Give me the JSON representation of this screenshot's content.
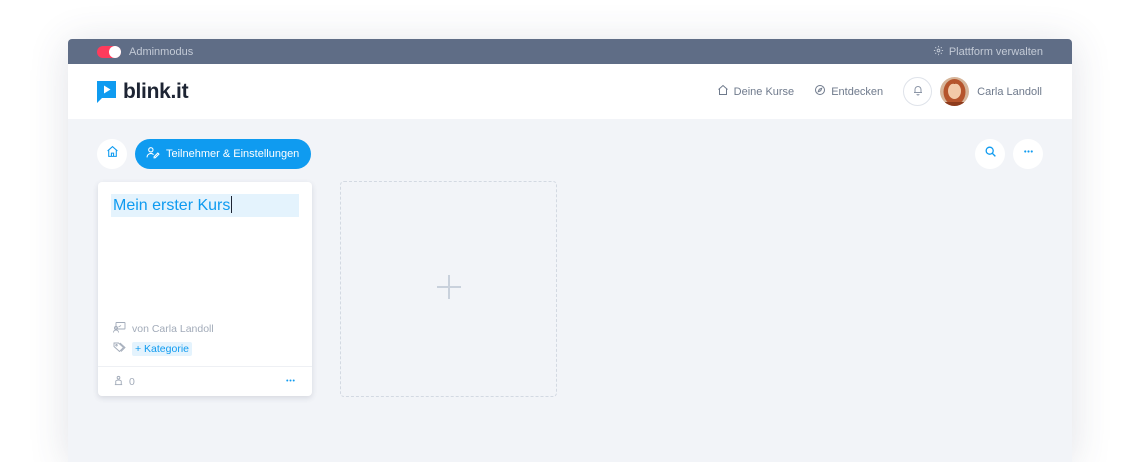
{
  "adminbar": {
    "admin_mode_label": "Adminmodus",
    "admin_mode_on": true,
    "manage_platform_label": "Plattform verwalten"
  },
  "header": {
    "brand": "blink.it",
    "nav": [
      {
        "label": "Deine Kurse",
        "icon": "home-icon"
      },
      {
        "label": "Entdecken",
        "icon": "compass-icon"
      }
    ],
    "user_name": "Carla Landoll"
  },
  "toolbar": {
    "participants_settings_label": "Teilnehmer & Einstellungen"
  },
  "course_card": {
    "title": "Mein erster Kurs",
    "author": "von Carla Landoll",
    "category_label": "+ Kategorie",
    "participants_count": "0"
  },
  "colors": {
    "accent": "#0f9bf0",
    "adminbar": "#5f6d86",
    "toggle_on": "#ff3b5c",
    "background": "#f2f4f8"
  }
}
